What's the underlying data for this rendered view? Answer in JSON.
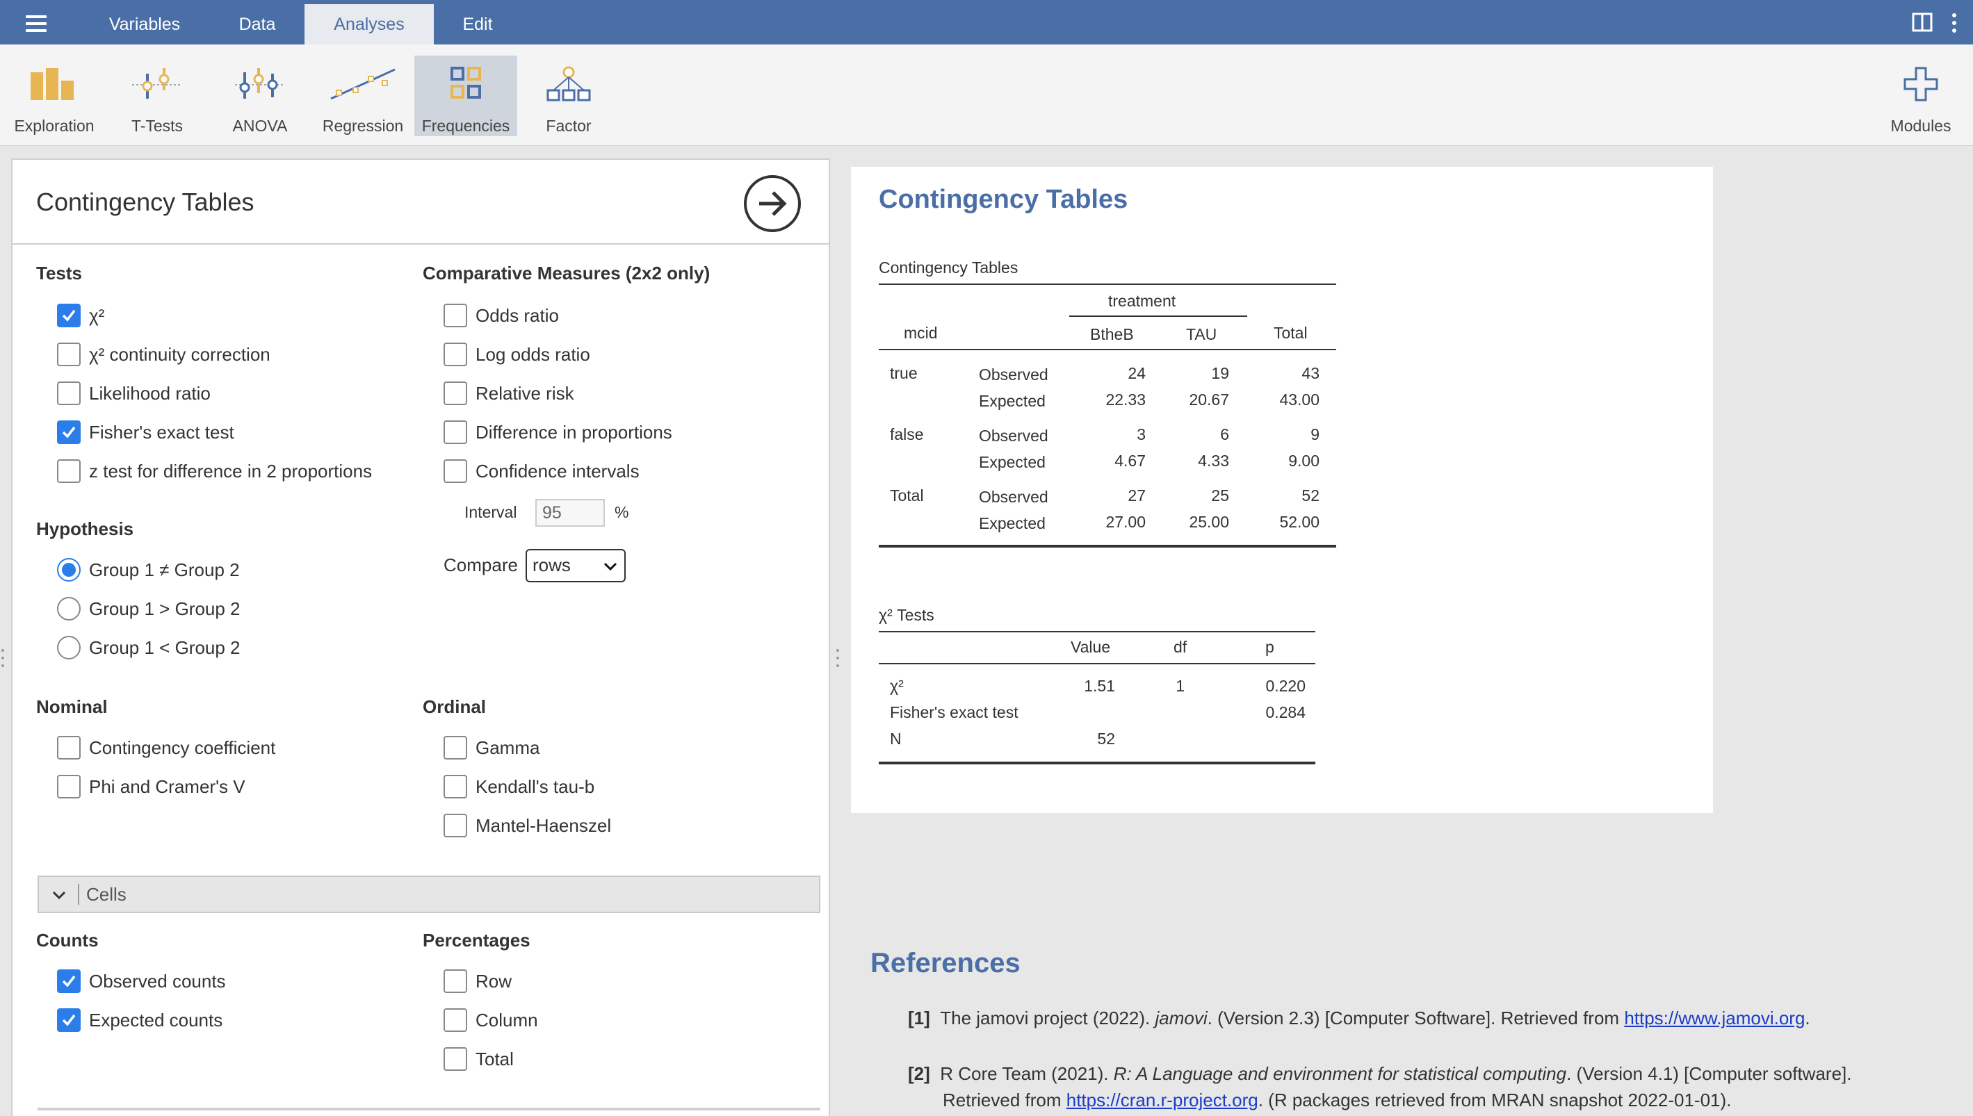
{
  "topbar": {
    "tabs": [
      {
        "label": "Variables"
      },
      {
        "label": "Data"
      },
      {
        "label": "Analyses"
      },
      {
        "label": "Edit"
      }
    ]
  },
  "ribbon": {
    "buttons": [
      {
        "label": "Exploration"
      },
      {
        "label": "T-Tests"
      },
      {
        "label": "ANOVA"
      },
      {
        "label": "Regression"
      },
      {
        "label": "Frequencies"
      },
      {
        "label": "Factor"
      }
    ],
    "modules_label": "Modules",
    "active": "Frequencies"
  },
  "options": {
    "title": "Contingency Tables",
    "tests": {
      "heading": "Tests",
      "items": [
        {
          "label": "χ²",
          "checked": true
        },
        {
          "label": "χ² continuity correction",
          "checked": false
        },
        {
          "label": "Likelihood ratio",
          "checked": false
        },
        {
          "label": "Fisher's exact test",
          "checked": true
        },
        {
          "label": "z test for difference in 2 proportions",
          "checked": false
        }
      ]
    },
    "comparative": {
      "heading": "Comparative Measures (2x2 only)",
      "items": [
        {
          "label": "Odds ratio",
          "checked": false
        },
        {
          "label": "Log odds ratio",
          "checked": false
        },
        {
          "label": "Relative risk",
          "checked": false
        },
        {
          "label": "Difference in proportions",
          "checked": false
        },
        {
          "label": "Confidence intervals",
          "checked": false
        }
      ],
      "interval_label": "Interval",
      "interval_value": "95",
      "interval_unit": "%",
      "compare_label": "Compare",
      "compare_value": "rows"
    },
    "hypothesis": {
      "heading": "Hypothesis",
      "items": [
        {
          "label": "Group 1 ≠ Group 2",
          "selected": true
        },
        {
          "label": "Group 1 > Group 2",
          "selected": false
        },
        {
          "label": "Group 1 < Group 2",
          "selected": false
        }
      ]
    },
    "nominal": {
      "heading": "Nominal",
      "items": [
        {
          "label": "Contingency coefficient",
          "checked": false
        },
        {
          "label": "Phi and Cramer's V",
          "checked": false
        }
      ]
    },
    "ordinal": {
      "heading": "Ordinal",
      "items": [
        {
          "label": "Gamma",
          "checked": false
        },
        {
          "label": "Kendall's tau-b",
          "checked": false
        },
        {
          "label": "Mantel-Haenszel",
          "checked": false
        }
      ]
    },
    "cells_label": "Cells",
    "counts": {
      "heading": "Counts",
      "items": [
        {
          "label": "Observed counts",
          "checked": true
        },
        {
          "label": "Expected counts",
          "checked": true
        }
      ]
    },
    "percentages": {
      "heading": "Percentages",
      "items": [
        {
          "label": "Row",
          "checked": false
        },
        {
          "label": "Column",
          "checked": false
        },
        {
          "label": "Total",
          "checked": false
        }
      ]
    }
  },
  "results": {
    "title": "Contingency Tables",
    "table1": {
      "caption": "Contingency Tables",
      "group_header": "treatment",
      "row_var": "mcid",
      "columns": [
        "BtheB",
        "TAU",
        "Total"
      ],
      "rows": [
        {
          "group": "true",
          "stat": "Observed",
          "values": [
            "24",
            "19",
            "43"
          ]
        },
        {
          "group": "",
          "stat": "Expected",
          "values": [
            "22.33",
            "20.67",
            "43.00"
          ]
        },
        {
          "group": "false",
          "stat": "Observed",
          "values": [
            "3",
            "6",
            "9"
          ]
        },
        {
          "group": "",
          "stat": "Expected",
          "values": [
            "4.67",
            "4.33",
            "9.00"
          ]
        },
        {
          "group": "Total",
          "stat": "Observed",
          "values": [
            "27",
            "25",
            "52"
          ]
        },
        {
          "group": "",
          "stat": "Expected",
          "values": [
            "27.00",
            "25.00",
            "52.00"
          ]
        }
      ]
    },
    "table2": {
      "caption": "χ² Tests",
      "columns": [
        "Value",
        "df",
        "p"
      ],
      "rows": [
        {
          "label": "χ²",
          "values": [
            "1.51",
            "1",
            "0.220"
          ]
        },
        {
          "label": "Fisher's exact test",
          "values": [
            "",
            "",
            "0.284"
          ]
        },
        {
          "label": "N",
          "values": [
            "52",
            "",
            ""
          ]
        }
      ]
    }
  },
  "references": {
    "heading": "References",
    "items": [
      {
        "num": "[1]",
        "pre": "The jamovi project (2022). ",
        "italic": "jamovi",
        "post": ". (Version 2.3) [Computer Software]. Retrieved from ",
        "link": "https://www.jamovi.org",
        "end": "."
      },
      {
        "num": "[2]",
        "pre": "R Core Team (2021). ",
        "italic": "R: A Language and environment for statistical computing",
        "post": ". (Version 4.1) [Computer software].",
        "line2_pre": "Retrieved from ",
        "link": "https://cran.r-project.org",
        "line2_post": ". (R packages retrieved from MRAN snapshot 2022-01-01)."
      }
    ]
  },
  "colors": {
    "topbar": "#4a6ea6",
    "accent": "#2b7de9",
    "heading": "#4a6ea6"
  }
}
